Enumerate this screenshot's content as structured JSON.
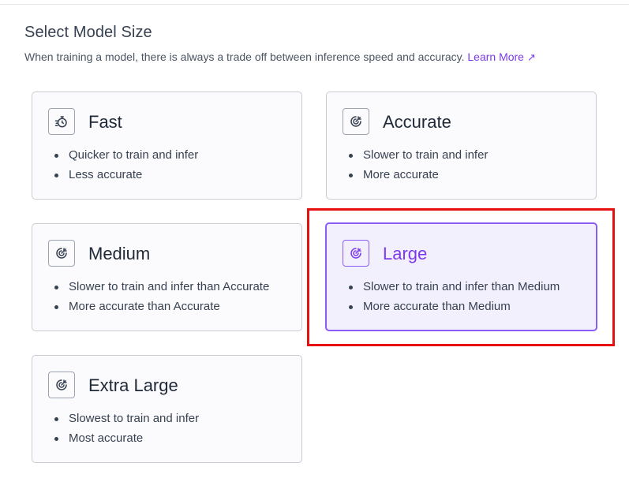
{
  "header": {
    "title": "Select Model Size",
    "subtitle": "When training a model, there is always a trade off between inference speed and accuracy.",
    "learn_more_label": "Learn More",
    "learn_more_icon": "external-arrow-icon"
  },
  "options": {
    "fast": {
      "title": "Fast",
      "icon": "stopwatch-icon",
      "bullets": [
        "Quicker to train and infer",
        "Less accurate"
      ]
    },
    "accurate": {
      "title": "Accurate",
      "icon": "target-icon",
      "bullets": [
        "Slower to train and infer",
        "More accurate"
      ]
    },
    "medium": {
      "title": "Medium",
      "icon": "target-icon",
      "bullets": [
        "Slower to train and infer than Accurate",
        "More accurate than Accurate"
      ]
    },
    "large": {
      "title": "Large",
      "icon": "target-icon",
      "selected": true,
      "bullets": [
        "Slower to train and infer than Medium",
        "More accurate than Medium"
      ]
    },
    "extra_large": {
      "title": "Extra Large",
      "icon": "target-icon",
      "bullets": [
        "Slowest to train and infer",
        "Most accurate"
      ]
    }
  },
  "colors": {
    "accent": "#7c3aed",
    "selected_bg": "#f3f0fe",
    "highlight": "#e8100f"
  }
}
